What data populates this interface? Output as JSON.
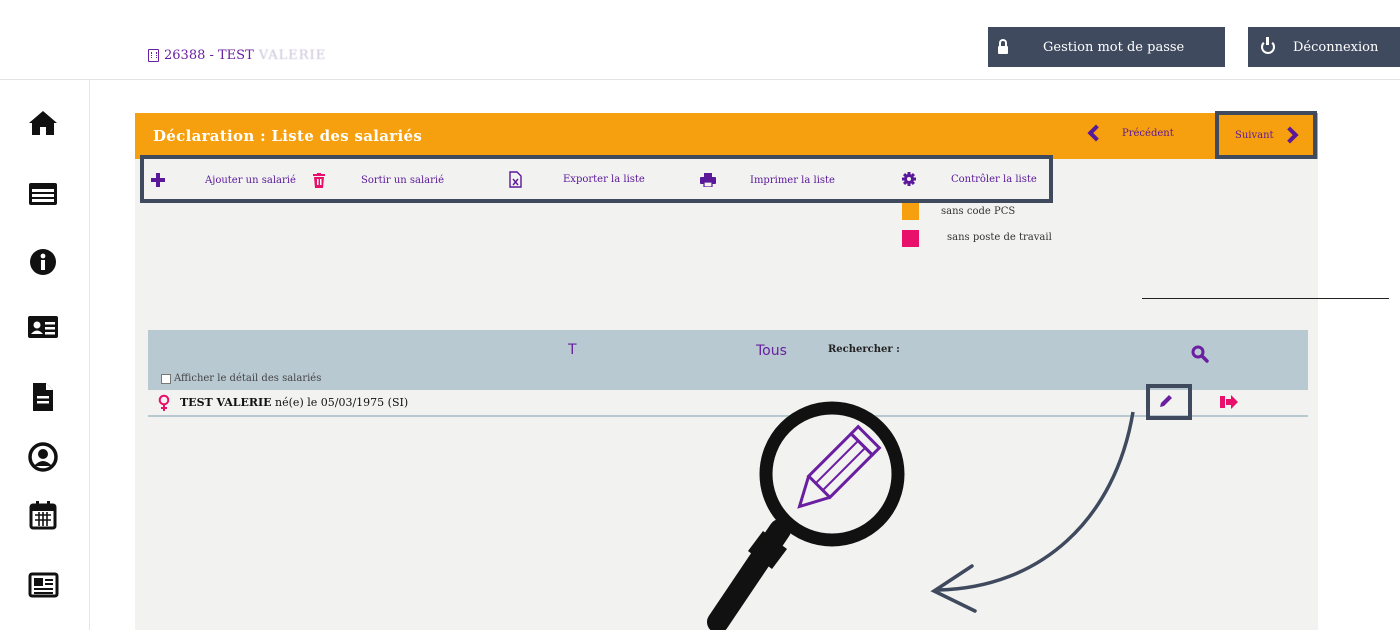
{
  "header": {
    "company_id": "26388 - TEST",
    "company_masked": "VALERIE",
    "password_button": "Gestion mot de passe",
    "logout_button": "Déconnexion"
  },
  "sidebar": {
    "items": [
      {
        "icon": "home-icon"
      },
      {
        "icon": "list-icon"
      },
      {
        "icon": "info-icon"
      },
      {
        "icon": "id-card-icon"
      },
      {
        "icon": "document-icon"
      },
      {
        "icon": "user-circle-icon"
      },
      {
        "icon": "calendar-icon"
      },
      {
        "icon": "newspaper-icon"
      }
    ]
  },
  "panel": {
    "title": "Déclaration : Liste des salariés",
    "prev_label": "Précédent",
    "next_label": "Suivant"
  },
  "toolbar": {
    "add": "Ajouter un salarié",
    "remove": "Sortir un salarié",
    "export": "Exporter la liste",
    "print": "Imprimer la liste",
    "check": "Contrôler la liste"
  },
  "legend": {
    "items": [
      {
        "label": "sans code PCS",
        "color": "#f7a00f"
      },
      {
        "label": "sans poste de travail",
        "color": "#e8106a"
      }
    ]
  },
  "list": {
    "filter_letter": "T",
    "filter_all": "Tous",
    "search_label": "Rechercher :",
    "detail_checkbox": "Afficher le détail des salariés",
    "rows": [
      {
        "name": "TEST VALERIE",
        "details": " né(e) le 05/03/1975 (SI)"
      }
    ]
  },
  "colors": {
    "accent_orange": "#f7a00f",
    "accent_purple": "#6a1fa0",
    "dark_button": "#3f4a5e",
    "list_header": "#b9c9d2"
  }
}
